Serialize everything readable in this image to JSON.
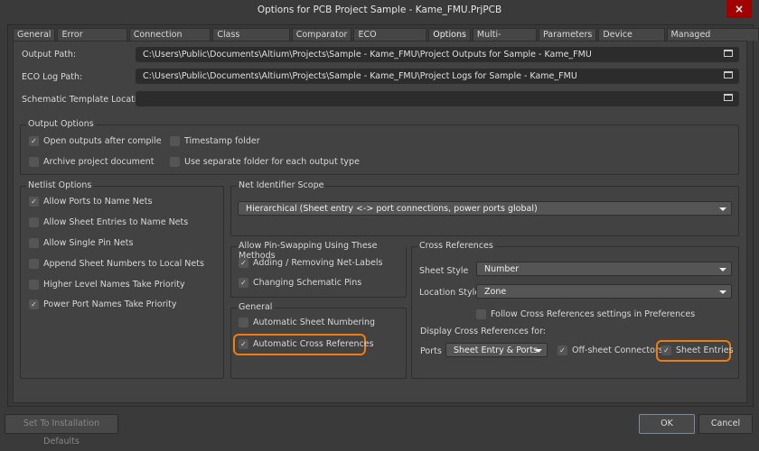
{
  "window": {
    "title": "Options for PCB Project Sample - Kame_FMU.PrjPCB",
    "close_label": "×"
  },
  "tabs": [
    "General",
    "Error Reporting",
    "Connection Matrix",
    "Class Generation",
    "Comparator",
    "ECO Generation",
    "Options",
    "Multi-Channel",
    "Parameters",
    "Device Sheets",
    "Managed OutputJobs"
  ],
  "paths": {
    "output_label": "Output Path:",
    "output_value": "C:\\Users\\Public\\Documents\\Altium\\Projects\\Sample - Kame_FMU\\Project Outputs for Sample - Kame_FMU",
    "eco_label": "ECO Log Path:",
    "eco_value": "C:\\Users\\Public\\Documents\\Altium\\Projects\\Sample - Kame_FMU\\Project Logs for Sample - Kame_FMU",
    "template_label": "Schematic Template Location:",
    "template_value": ""
  },
  "output_options": {
    "title": "Output Options",
    "items": [
      {
        "label": "Open outputs after compile",
        "checked": true
      },
      {
        "label": "Timestamp folder",
        "checked": false
      },
      {
        "label": "Archive project document",
        "checked": false
      },
      {
        "label": "Use separate folder for each output type",
        "checked": false
      }
    ]
  },
  "netlist_options": {
    "title": "Netlist Options",
    "items": [
      {
        "label": "Allow Ports to Name Nets",
        "checked": true
      },
      {
        "label": "Allow Sheet Entries to Name Nets",
        "checked": false
      },
      {
        "label": "Allow Single Pin Nets",
        "checked": false
      },
      {
        "label": "Append Sheet Numbers to Local Nets",
        "checked": false
      },
      {
        "label": "Higher Level Names Take Priority",
        "checked": false
      },
      {
        "label": "Power Port Names Take Priority",
        "checked": true
      }
    ]
  },
  "net_identifier": {
    "title": "Net Identifier Scope",
    "value": "Hierarchical (Sheet entry <-> port connections, power ports global)"
  },
  "pin_swapping": {
    "title": "Allow Pin-Swapping Using These Methods",
    "items": [
      {
        "label": "Adding / Removing Net-Labels",
        "checked": true
      },
      {
        "label": "Changing Schematic Pins",
        "checked": true
      }
    ]
  },
  "general": {
    "title": "General",
    "items": [
      {
        "label": "Automatic Sheet Numbering",
        "checked": false
      },
      {
        "label": "Automatic Cross References",
        "checked": true
      }
    ]
  },
  "cross_refs": {
    "title": "Cross References",
    "sheet_style_label": "Sheet Style",
    "sheet_style": "Number",
    "location_style_label": "Location Style",
    "location_style": "Zone",
    "follow_label": "Follow Cross References settings in Preferences",
    "display_label": "Display Cross References for:",
    "ports_label": "Ports",
    "ports_value": "Sheet Entry & Ports",
    "offsheet_label": "Off-sheet Connectors",
    "sheet_entries_label": "Sheet Entries"
  },
  "buttons": {
    "defaults": "Set To Installation Defaults",
    "ok": "OK",
    "cancel": "Cancel"
  },
  "check": "✓"
}
